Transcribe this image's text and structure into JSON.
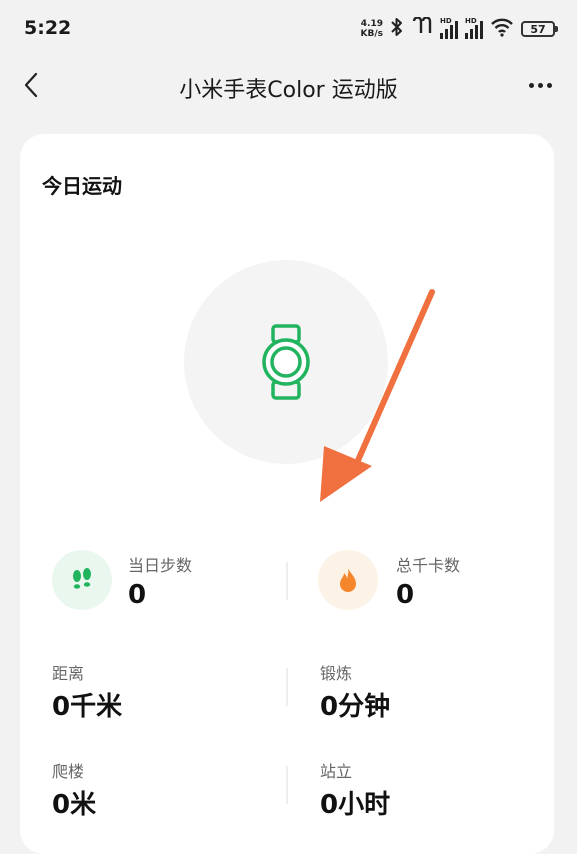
{
  "status_bar": {
    "time": "5:22",
    "net_speed_value": "4.19",
    "net_speed_unit": "KB/s",
    "sim1_label": "HD",
    "sim2_label": "HD",
    "battery": "57"
  },
  "header": {
    "title": "小米手表Color 运动版"
  },
  "today": {
    "title": "今日运动",
    "steps_label": "当日步数",
    "steps_value": "0",
    "calories_label": "总千卡数",
    "calories_value": "0",
    "distance_label": "距离",
    "distance_value": "0千米",
    "exercise_label": "锻炼",
    "exercise_value": "0分钟",
    "climb_label": "爬楼",
    "climb_value": "0米",
    "stand_label": "站立",
    "stand_value": "0小时"
  },
  "colors": {
    "accent_green": "#22b35e",
    "flame_orange": "#f5862b",
    "arrow_orange": "#f0703f"
  }
}
